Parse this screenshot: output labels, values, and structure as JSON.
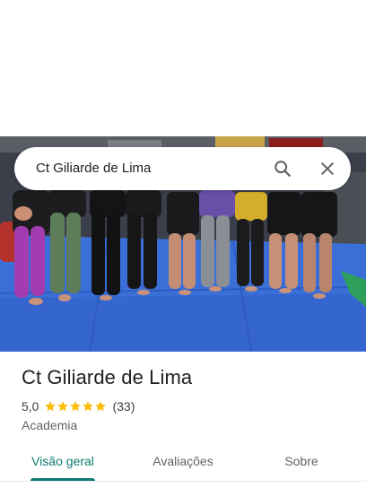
{
  "search": {
    "value": "Ct Giliarde de Lima",
    "search_icon": "search-icon",
    "close_icon": "close-icon"
  },
  "photo": {
    "description_icon": "place-photo"
  },
  "place": {
    "title": "Ct Giliarde de Lima",
    "rating": "5,0",
    "stars": 5,
    "reviews": "(33)",
    "category": "Academia",
    "star_color": "#fbbc04"
  },
  "tabs": [
    {
      "label": "Visão geral",
      "active": true
    },
    {
      "label": "Avaliações",
      "active": false
    },
    {
      "label": "Sobre",
      "active": false
    }
  ],
  "colors": {
    "accent": "#0f7a72",
    "text_primary": "#202124",
    "text_secondary": "#5f6368",
    "mat_blue": "#3b6fd8"
  }
}
